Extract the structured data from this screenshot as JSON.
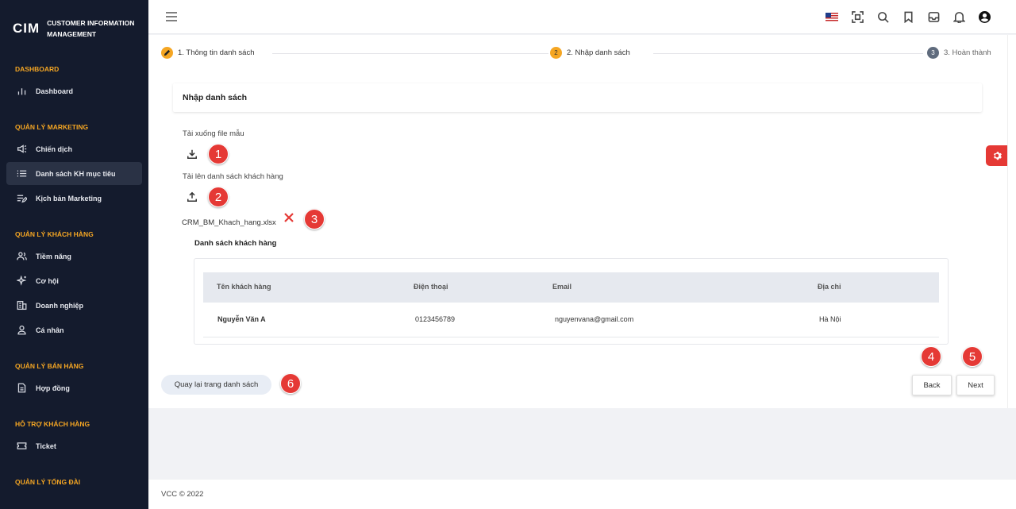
{
  "app": {
    "logo_mark": "CIM",
    "logo_text": "CUSTOMER INFORMATION MANAGEMENT"
  },
  "sidebar": {
    "sections": [
      {
        "title": "DASHBOARD",
        "items": [
          {
            "label": "Dashboard",
            "icon": "bar-chart-icon"
          }
        ]
      },
      {
        "title": "QUẢN LÝ MARKETING",
        "items": [
          {
            "label": "Chiến dịch",
            "icon": "megaphone-icon"
          },
          {
            "label": "Danh sách KH mục tiêu",
            "icon": "list-icon",
            "active": true
          },
          {
            "label": "Kịch bản Marketing",
            "icon": "playlist-edit-icon"
          }
        ]
      },
      {
        "title": "QUẢN LÝ KHÁCH HÀNG",
        "items": [
          {
            "label": "Tiềm năng",
            "icon": "users-icon"
          },
          {
            "label": "Cơ hội",
            "icon": "sparkle-icon"
          },
          {
            "label": "Doanh nghiệp",
            "icon": "building-icon"
          },
          {
            "label": "Cá nhân",
            "icon": "user-icon"
          }
        ]
      },
      {
        "title": "QUẢN LÝ BÁN HÀNG",
        "items": [
          {
            "label": "Hợp đồng",
            "icon": "document-icon"
          }
        ]
      },
      {
        "title": "HỖ TRỢ KHÁCH HÀNG",
        "items": [
          {
            "label": "Ticket",
            "icon": "ticket-icon"
          }
        ]
      },
      {
        "title": "QUẢN LÝ TỔNG ĐÀI",
        "items": []
      }
    ]
  },
  "topbar": {
    "icons": [
      "us-flag-icon",
      "fullscreen-icon",
      "search-icon",
      "bookmark-icon",
      "inbox-icon",
      "bell-icon",
      "account-icon"
    ]
  },
  "stepper": {
    "steps": [
      {
        "number": "",
        "label": "1. Thông tin danh sách",
        "state": "done"
      },
      {
        "number": "2",
        "label": "2. Nhập danh sách",
        "state": "active"
      },
      {
        "number": "3",
        "label": "3. Hoàn thành",
        "state": "pending"
      }
    ]
  },
  "main": {
    "card_title": "Nhập danh sách",
    "download_label": "Tải xuống file mẫu",
    "upload_label": "Tải lên danh sách khách hàng",
    "file_name": "CRM_BM_Khach_hang.xlsx",
    "table_title": "Danh sách khách hàng",
    "columns": [
      "Tên khách hàng",
      "Điện thoại",
      "Email",
      "Địa chỉ"
    ],
    "rows": [
      {
        "name": "Nguyễn Văn A",
        "phone": "0123456789",
        "email": "nguyenvana@gmail.com",
        "address": "Hà Nội"
      }
    ],
    "back_to_list_label": "Quay lại trang danh sách",
    "back_label": "Back",
    "next_label": "Next"
  },
  "badges": [
    "1",
    "2",
    "3",
    "4",
    "5",
    "6"
  ],
  "colors": {
    "accent": "#f5a623",
    "sidebar_bg": "#141b2d",
    "danger": "#e53935",
    "step_pending": "#5f6b7d"
  },
  "footer": {
    "text": "VCC © 2022"
  }
}
